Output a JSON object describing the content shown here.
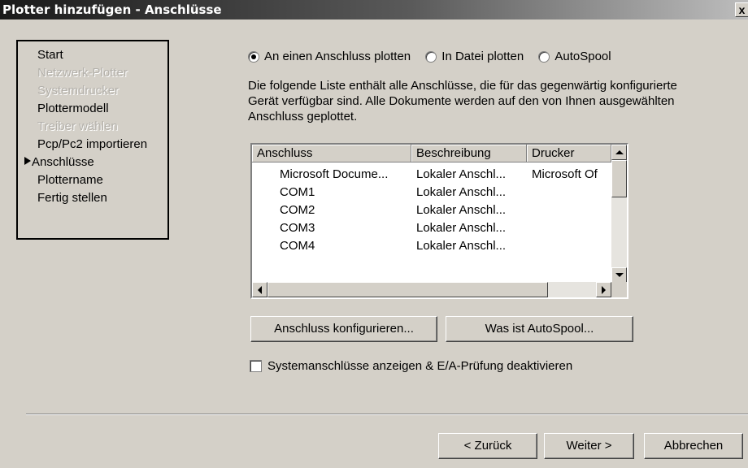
{
  "window": {
    "title": "Plotter hinzufügen - Anschlüsse",
    "close_label": "x"
  },
  "steps": [
    {
      "label": "Start",
      "state": "enabled"
    },
    {
      "label": "Netzwerk-Plotter",
      "state": "disabled"
    },
    {
      "label": "Systemdrucker",
      "state": "disabled"
    },
    {
      "label": "Plottermodell",
      "state": "enabled"
    },
    {
      "label": "Treiber wählen",
      "state": "disabled"
    },
    {
      "label": "Pcp/Pc2 importieren",
      "state": "enabled"
    },
    {
      "label": "Anschlüsse",
      "state": "current"
    },
    {
      "label": "Plottername",
      "state": "enabled"
    },
    {
      "label": "Fertig stellen",
      "state": "enabled"
    }
  ],
  "plot_options": [
    {
      "label": "An einen Anschluss plotten",
      "selected": true
    },
    {
      "label": "In Datei plotten",
      "selected": false
    },
    {
      "label": "AutoSpool",
      "selected": false
    }
  ],
  "description": "Die folgende Liste enthält alle Anschlüsse, die für das gegenwärtig konfigurierte Gerät verfügbar sind. Alle Dokumente werden auf den von Ihnen ausgewählten Anschluss geplottet.",
  "port_list": {
    "columns": [
      "Anschluss",
      "Beschreibung",
      "Drucker"
    ],
    "rows": [
      [
        "Microsoft Docume...",
        "Lokaler Anschl...",
        "Microsoft Of"
      ],
      [
        "COM1",
        "Lokaler Anschl...",
        ""
      ],
      [
        "COM2",
        "Lokaler Anschl...",
        ""
      ],
      [
        "COM3",
        "Lokaler Anschl...",
        ""
      ],
      [
        "COM4",
        "Lokaler Anschl...",
        ""
      ]
    ]
  },
  "buttons": {
    "configure_port": "Anschluss konfigurieren...",
    "what_is_autospool": "Was ist AutoSpool...",
    "back": "< Zurück",
    "next": "Weiter >",
    "cancel": "Abbrechen"
  },
  "system_ports_checkbox": {
    "label": "Systemanschlüsse anzeigen & E/A-Prüfung deaktivieren",
    "checked": false
  }
}
